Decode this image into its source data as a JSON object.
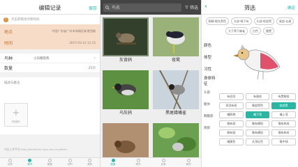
{
  "panel1": {
    "title": "编辑记录",
    "save": "保存",
    "warning": "点击获取地点和时间",
    "location_label": "地点",
    "location_value": "中国广东省广州市海珠区新港西路",
    "time_label": "时间",
    "time_value": "2017-03-12 11:15",
    "species_label": "鸟种",
    "species_value": "小白腰雨燕",
    "count_label": "数量",
    "count_value": "25只",
    "memo_label": "描述与备注",
    "add_photo_label": "添加照片",
    "footer_link": "鸟友上传平台 http://birdshare.sysu.edu.cn/admin",
    "tabs": [
      "记录",
      "观鸟",
      "图鉴",
      "识别",
      "我的"
    ]
  },
  "panel2": {
    "search_placeholder": "鸟名",
    "filter_label": "筛选",
    "birds": [
      "灰背鸫",
      "夜鹭",
      "乌灰鸫",
      "黑尾蜡嘴雀",
      "",
      ""
    ],
    "tabs": [
      "图鉴",
      "观鸟",
      "记录",
      "我的"
    ]
  },
  "panel3": {
    "title": "筛选",
    "confirm": "确定",
    "chips": [
      "眼睛-眼先黑色",
      "头部-喉下有",
      "头部-枕部黑",
      "尾部-长尾",
      "大于等于麻雀",
      "白色",
      "重置"
    ],
    "sections": [
      "颜色",
      "体型",
      "习性",
      "身体特征",
      "头部",
      "躯体",
      "胸腹部",
      "喙部"
    ],
    "options": [
      [
        "有冠羽",
        "有眉纹",
        "有贯眼纹"
      ],
      [
        "耳羽有斑",
        "喉部黑色",
        "枕部黑"
      ],
      [
        "嘴鲜艳",
        "嘴下弯",
        "嘴上弯"
      ],
      [
        "喉有斑",
        "喉有横斑",
        "喉有纵纹"
      ],
      [
        "喉有斑",
        "喉有横纹",
        "喉有纵纹"
      ],
      [
        "嘴黄色",
        "头顶红色",
        "喉中线"
      ]
    ],
    "selected_option": "嘴下弯",
    "highlighted_chip": "枕部黑"
  }
}
